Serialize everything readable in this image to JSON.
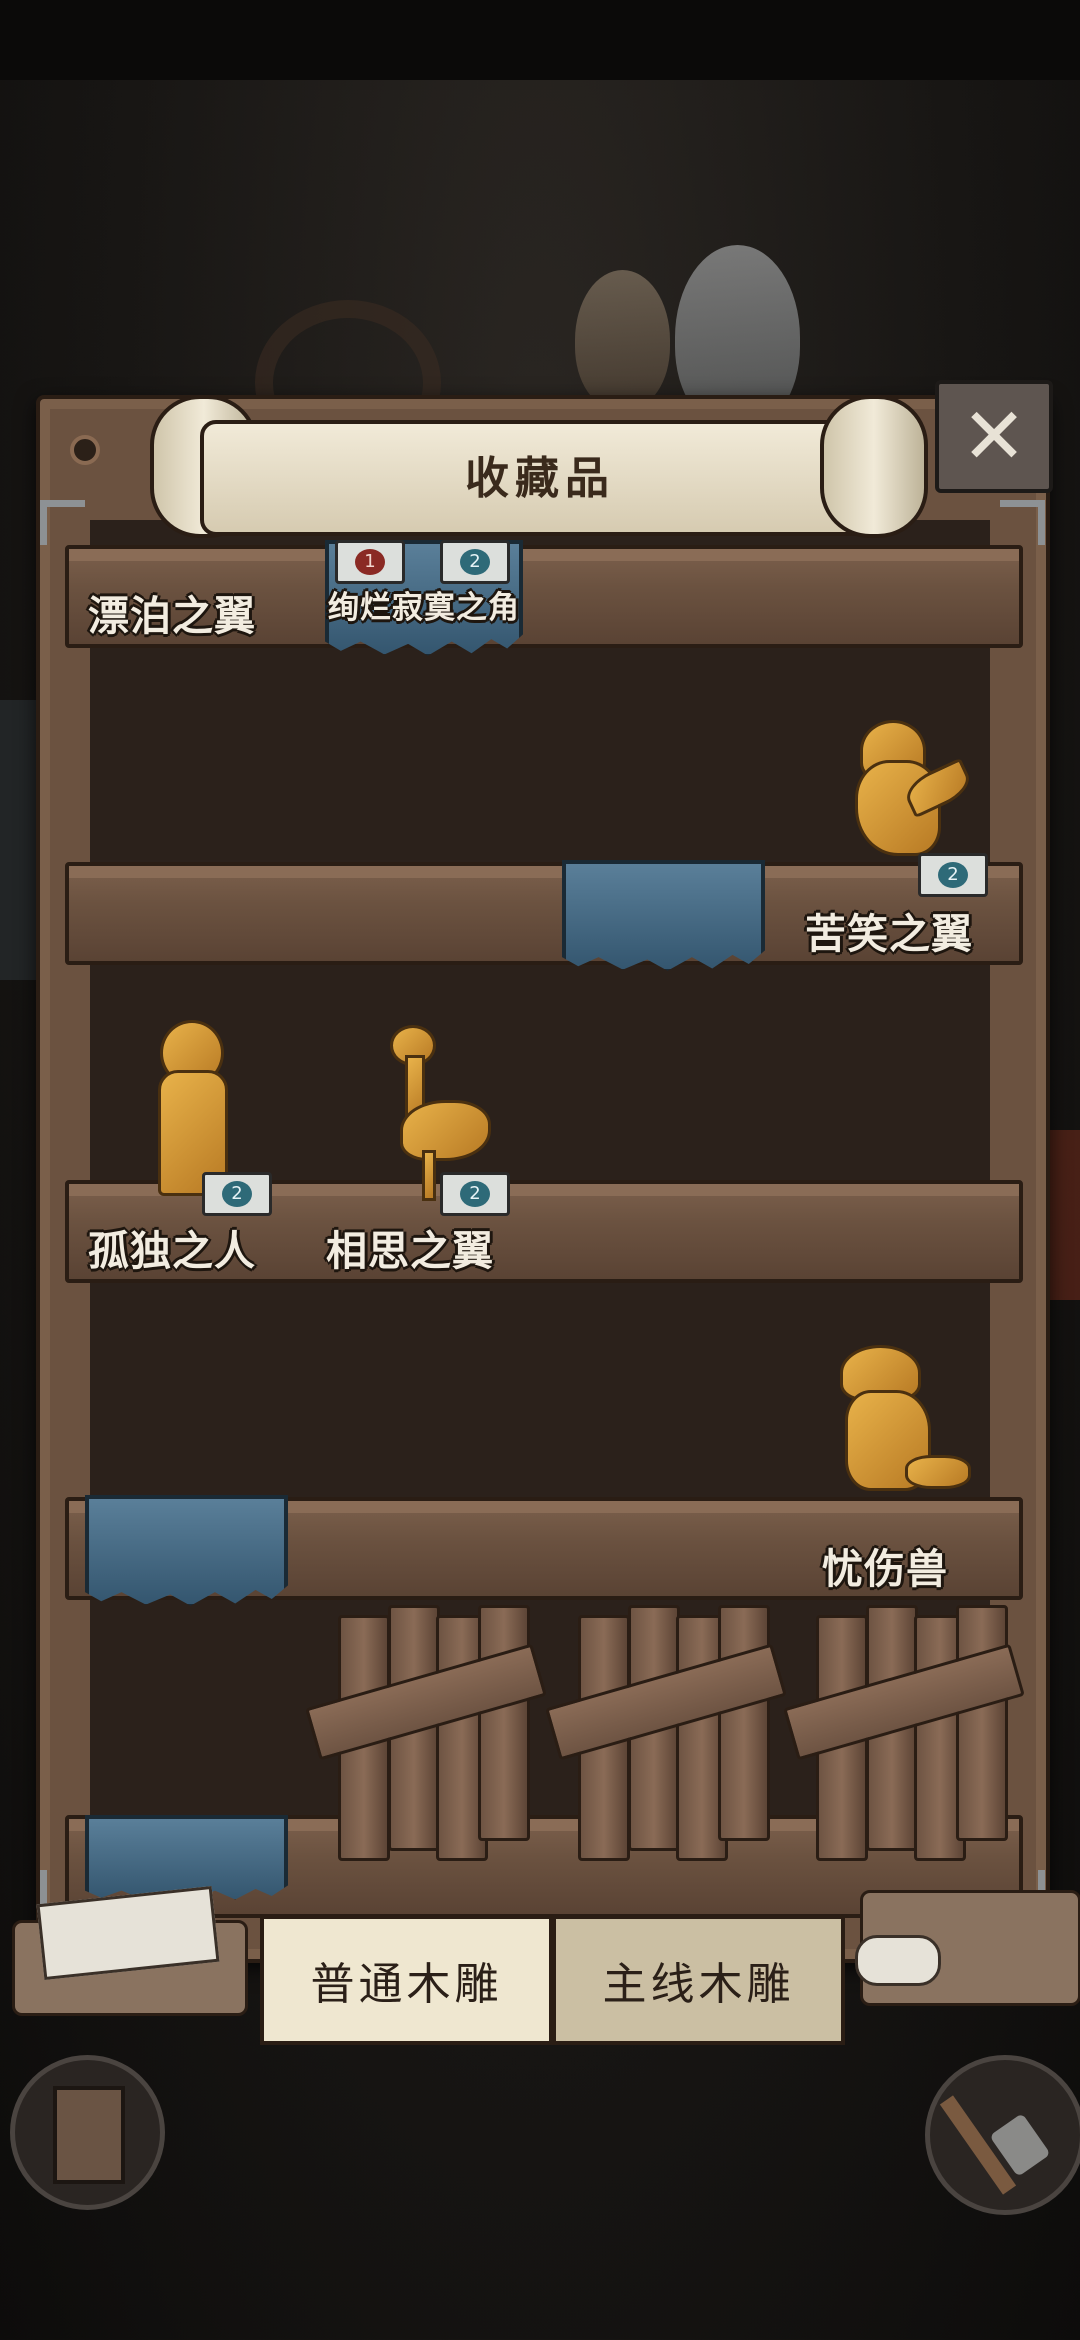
{
  "header": {
    "title": "收藏品",
    "close_icon": "close-x-icon"
  },
  "shelves": [
    {
      "items": [
        {
          "name": "漂泊之翼"
        },
        {
          "name": "绚烂寂寞之角",
          "badges": [
            "1",
            "2"
          ]
        }
      ]
    },
    {
      "items": [
        {
          "name": "苦笑之翼",
          "badge": "2"
        }
      ]
    },
    {
      "items": [
        {
          "name": "孤独之人",
          "badge": "2"
        },
        {
          "name": "相思之翼",
          "badge": "2"
        }
      ]
    },
    {
      "items": [
        {
          "name": "忧伤兽"
        }
      ]
    }
  ],
  "tabs": [
    {
      "label": "普通木雕",
      "active": true
    },
    {
      "label": "主线木雕",
      "active": false
    }
  ],
  "colors": {
    "cloth": "#4a6f88",
    "wood": "#6b5240",
    "figurine": "#d89a38",
    "badge_teal": "#2e6a78"
  }
}
